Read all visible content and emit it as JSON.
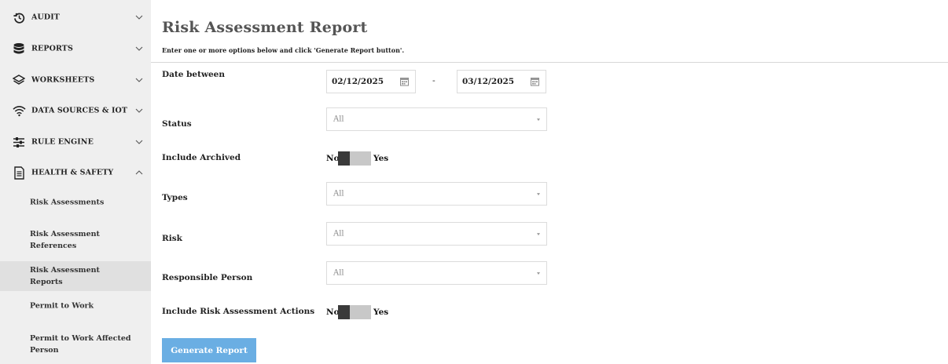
{
  "sidebar": {
    "items": [
      {
        "label": "AUDIT",
        "icon": "history-icon"
      },
      {
        "label": "REPORTS",
        "icon": "database-icon"
      },
      {
        "label": "WORKSHEETS",
        "icon": "layers-icon"
      },
      {
        "label": "DATA SOURCES & IOT",
        "icon": "wifi-icon"
      },
      {
        "label": "RULE ENGINE",
        "icon": "sliders-icon"
      },
      {
        "label": "HEALTH & SAFETY",
        "icon": "document-icon"
      }
    ],
    "sub_items": [
      {
        "label": "Risk Assessments"
      },
      {
        "label": "Risk Assessment References"
      },
      {
        "label": "Risk Assessment Reports"
      },
      {
        "label": "Permit to Work"
      },
      {
        "label": "Permit to Work Affected Person"
      }
    ]
  },
  "page": {
    "title": "Risk Assessment Report",
    "subtitle": "Enter one or more options below and click 'Generate Report button'."
  },
  "form": {
    "date_label": "Date between",
    "date_from": "02/12/2025",
    "date_separator": "-",
    "date_to": "03/12/2025",
    "status_label": "Status",
    "status_value": "All",
    "archived_label": "Include Archived",
    "toggle_no": "No",
    "toggle_yes": "Yes",
    "types_label": "Types",
    "types_value": "All",
    "risk_label": "Risk",
    "risk_value": "All",
    "person_label": "Responsible Person",
    "person_value": "All",
    "actions_label": "Include Risk Assessment Actions",
    "generate_label": "Generate Report"
  },
  "colors": {
    "sidebar_bg": "#efefef",
    "active_item_bg": "#e0e0e0",
    "button_bg": "#6aaee3",
    "toggle_track": "#c8c8c8",
    "toggle_knob": "#3a3a3a"
  }
}
